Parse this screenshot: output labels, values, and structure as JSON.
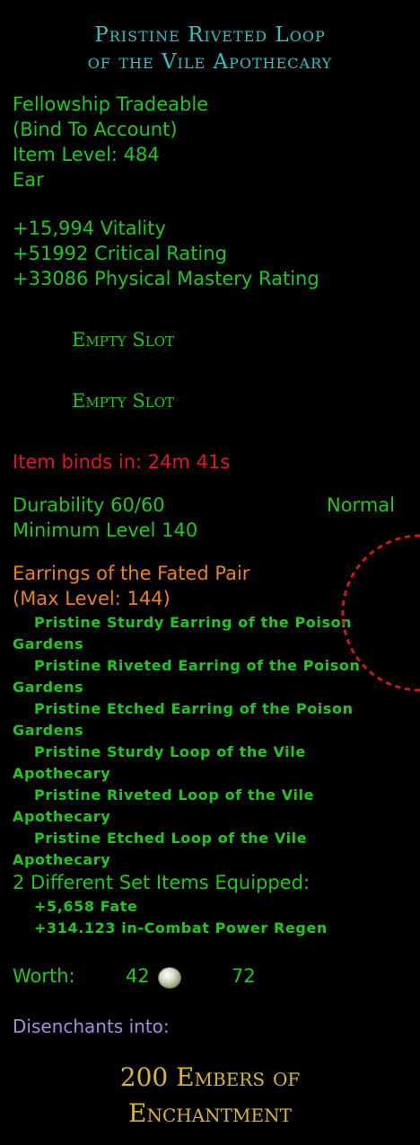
{
  "item": {
    "title_line1": "Pristine Riveted Loop",
    "title_line2": "of the Vile Apothecary",
    "trade": "Fellowship Tradeable",
    "bind": "(Bind To Account)",
    "item_level": "Item Level: 484",
    "slot_type": "Ear"
  },
  "stats": [
    "+15,994 Vitality",
    "+51992 Critical Rating",
    "+33086 Physical Mastery Rating"
  ],
  "essence_slots": [
    "Empty Slot",
    "Empty Slot"
  ],
  "binds_in": "Item binds in: 24m 41s",
  "durability": "Durability 60/60",
  "durability_type": "Normal",
  "min_level": "Minimum Level 140",
  "set": {
    "name": "Earrings of the Fated Pair",
    "max_level": "(Max Level: 144)",
    "items": [
      {
        "line1": "Pristine Sturdy Earring of the Poison",
        "line2": "Gardens"
      },
      {
        "line1": "Pristine Riveted Earring of the Poison",
        "line2": "Gardens"
      },
      {
        "line1": "Pristine Etched Earring of the Poison",
        "line2": "Gardens"
      },
      {
        "line1": "Pristine Sturdy Loop of the Vile",
        "line2": "Apothecary"
      },
      {
        "line1": "Pristine Riveted Loop of the Vile",
        "line2": "Apothecary"
      },
      {
        "line1": "Pristine Etched Loop of the Vile",
        "line2": "Apothecary"
      }
    ],
    "bonus_header": "2 Different Set Items Equipped:",
    "bonuses": [
      "+5,658 Fate",
      "+314.123 in-Combat Power Regen"
    ]
  },
  "worth": {
    "label": "Worth:",
    "silver": "42",
    "copper": "72"
  },
  "disenchant": {
    "label": "Disenchants into:",
    "line1": "200 Embers of",
    "line2": "Enchantment"
  },
  "colors": {
    "title": "#29c4c4",
    "green": "#1ec81e",
    "red": "#e01a1a",
    "orange": "#e8821e",
    "purple": "#a78be0",
    "gold": "#d8b829"
  }
}
